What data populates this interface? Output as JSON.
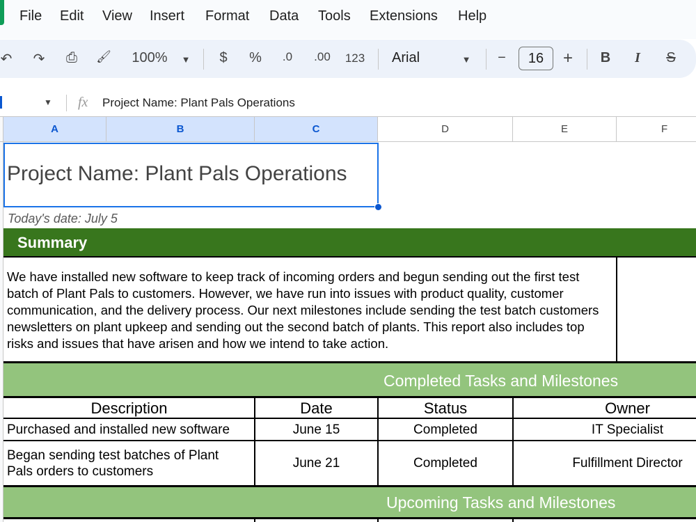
{
  "menu": [
    "File",
    "Edit",
    "View",
    "Insert",
    "Format",
    "Data",
    "Tools",
    "Extensions",
    "Help"
  ],
  "toolbar": {
    "undo": "↶",
    "redo": "↷",
    "print": "⎙",
    "paint": "🖌",
    "zoom": "100%",
    "currency": "$",
    "percent": "%",
    "dec_decrease": ".0",
    "dec_increase": ".00",
    "number_format": "123",
    "font": "Arial",
    "font_size": "16",
    "minus": "−",
    "plus": "+",
    "bold": "B",
    "italic": "I",
    "strike": "S"
  },
  "formula": {
    "fx": "fx",
    "value": "Project Name: Plant Pals Operations"
  },
  "columns": [
    "A",
    "B",
    "C",
    "D",
    "E",
    "F"
  ],
  "sheet": {
    "title": "Project Name: Plant Pals Operations",
    "date": "Today's date: July 5",
    "summary_header": "Summary",
    "summary_text": "We have installed new software to keep track of incoming orders and begun sending out the first test batch of Plant Pals to customers. However, we have run into issues with product quality, customer communication, and the delivery process. Our next milestones include sending the test batch customers newsletters on plant upkeep and sending out the second batch of plants. This report also includes top risks and issues that have arisen and how we intend to take action.",
    "completed_header": "Completed Tasks and Milestones",
    "table_headers": [
      "Description",
      "Date",
      "Status",
      "Owner"
    ],
    "rows": [
      {
        "description": "Purchased and installed new software",
        "date": "June 15",
        "status": "Completed",
        "owner": "IT Specialist"
      },
      {
        "description": "Began sending test batches of Plant Pals orders to customers",
        "date": "June 21",
        "status": "Completed",
        "owner": "Fulfillment Director"
      }
    ],
    "upcoming_header": "Upcoming Tasks and Milestones"
  },
  "colors": {
    "dark_green": "#38761d",
    "light_green": "#93c47d",
    "selection": "#1a73e8"
  }
}
